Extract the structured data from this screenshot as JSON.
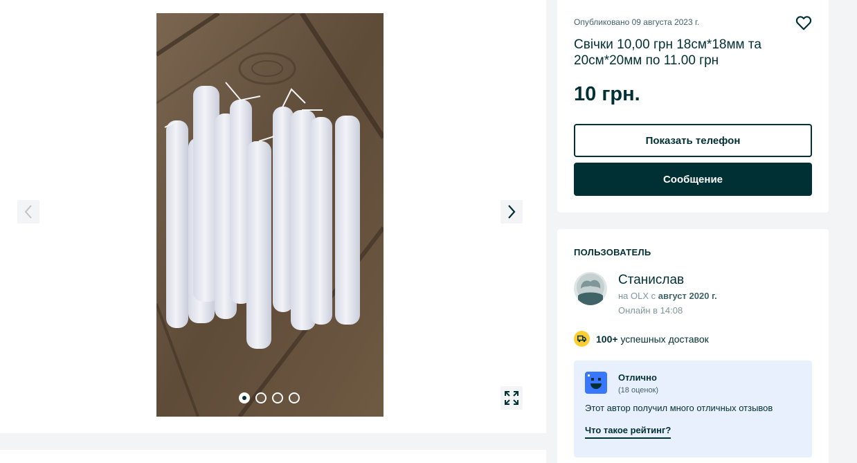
{
  "gallery": {
    "image_alt": "candles photo",
    "slides": 4,
    "active_slide": 1,
    "prev_icon": "chevron-left-icon",
    "next_icon": "chevron-right-icon",
    "fullscreen_icon": "expand-icon"
  },
  "ad": {
    "posted": "Опубликовано 09 августа 2023 г.",
    "title": "Свічки 10,00 грн 18см*18мм та 20см*20мм по 11.00 грн",
    "price": "10 грн.",
    "show_phone_label": "Показать телефон",
    "message_label": "Сообщение",
    "favorite_icon": "heart-icon"
  },
  "user": {
    "heading": "ПОЛЬЗОВАТЕЛЬ",
    "name": "Станислав",
    "since_prefix": "на OLX с ",
    "since_date": "август 2020 г.",
    "online": "Онлайн в 14:08",
    "deliveries_count": "100+",
    "deliveries_text": "успешных доставок",
    "rating": {
      "label": "Отлично",
      "count": "(18 оценок)",
      "description": "Этот автор получил много отличных отзывов",
      "link": "Что такое рейтинг?"
    }
  },
  "colors": {
    "primary": "#002f34",
    "background": "#f2f4f5",
    "delivery_badge": "#ffce32",
    "rating_bg": "#e8effd",
    "rating_face": "#3a77ff"
  }
}
